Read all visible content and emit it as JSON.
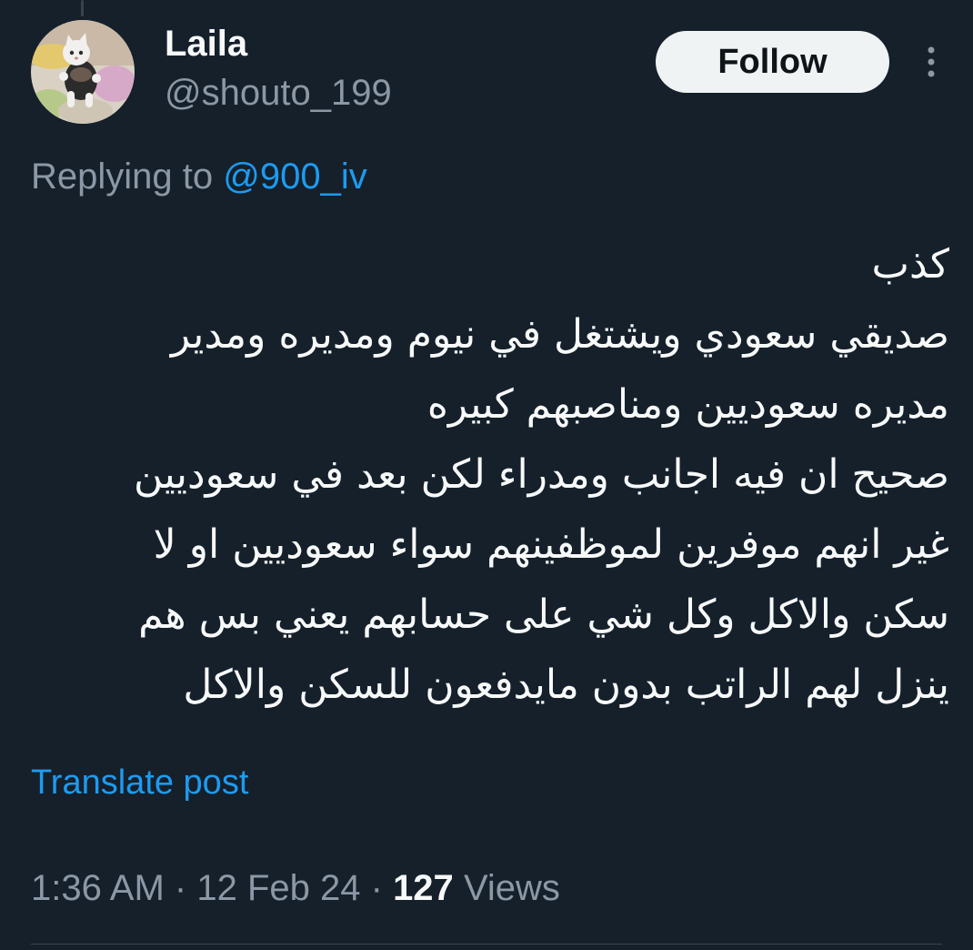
{
  "author": {
    "display_name": "Laila",
    "handle": "@shouto_199"
  },
  "follow_button": {
    "label": "Follow"
  },
  "more_menu": {
    "icon": "more-vertical-icon"
  },
  "reply_context": {
    "prefix": "Replying to",
    "mention": "@900_iv"
  },
  "tweet": {
    "lines": [
      "كذب",
      "صديقي سعودي ويشتغل في نيوم ومديره ومدير",
      "مديره سعوديين ومناصبهم كبيره",
      "صحيح ان فيه اجانب ومدراء لكن بعد في سعوديين",
      "غير انهم موفرين لموظفينهم سواء سعوديين او لا",
      "سكن والاكل وكل شي على حسابهم يعني بس هم",
      "ينزل لهم الراتب بدون مايدفعون للسكن والاكل"
    ]
  },
  "translate_link": "Translate post",
  "meta": {
    "time": "1:36 AM",
    "separator": "·",
    "date": "12 Feb 24",
    "views_count": "127",
    "views_label": "Views"
  },
  "colors": {
    "background": "#15202b",
    "text_primary": "#f7f9f9",
    "text_secondary": "#8b98a5",
    "accent": "#1d9bf0",
    "follow_button_bg": "#eff3f4",
    "divider": "#38444d"
  }
}
